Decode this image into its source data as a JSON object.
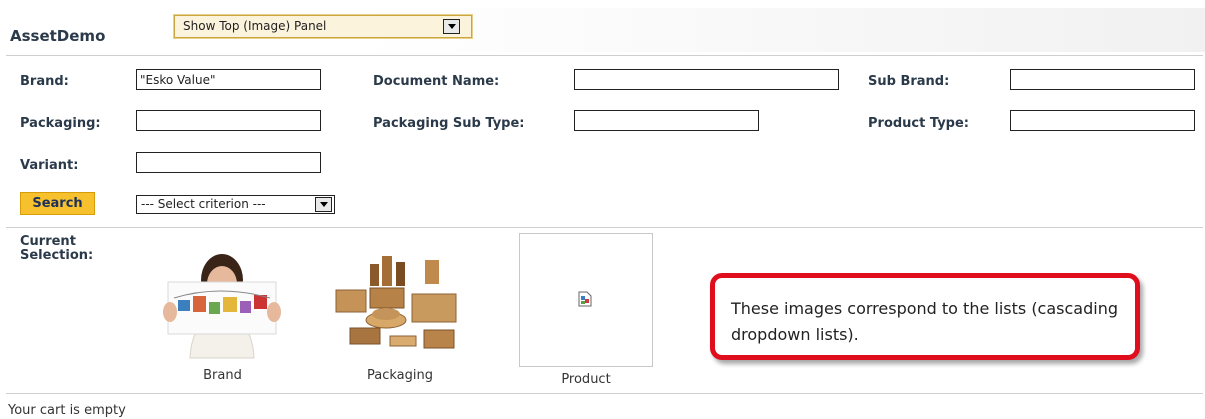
{
  "header": {
    "app_title": "AssetDemo",
    "panel_select_value": "Show Top (Image) Panel"
  },
  "form": {
    "brand_label": "Brand:",
    "brand_value": "\"Esko Value\"",
    "document_name_label": "Document Name:",
    "document_name_value": "",
    "sub_brand_label": "Sub Brand:",
    "sub_brand_value": "",
    "packaging_label": "Packaging:",
    "packaging_value": "",
    "packaging_sub_type_label": "Packaging Sub Type:",
    "packaging_sub_type_value": "",
    "product_type_label": "Product Type:",
    "product_type_value": "",
    "variant_label": "Variant:",
    "variant_value": "",
    "search_label": "Search",
    "criterion_value": "--- Select criterion ---"
  },
  "selection": {
    "label": "Current Selection:",
    "thumbnails": [
      {
        "caption": "Brand",
        "icon": "woman-holding-photo-collage"
      },
      {
        "caption": "Packaging",
        "icon": "wooden-packaging-boxes"
      },
      {
        "caption": "Product",
        "icon": "broken-image-icon"
      }
    ]
  },
  "callout": {
    "text": "These images correspond to the lists (cascading dropdown lists).",
    "border_color": "#e00d1c"
  },
  "cart": {
    "status": "Your cart is empty"
  },
  "colors": {
    "accent_button": "#f6c12c",
    "select_highlight": "#fbf3dc"
  }
}
